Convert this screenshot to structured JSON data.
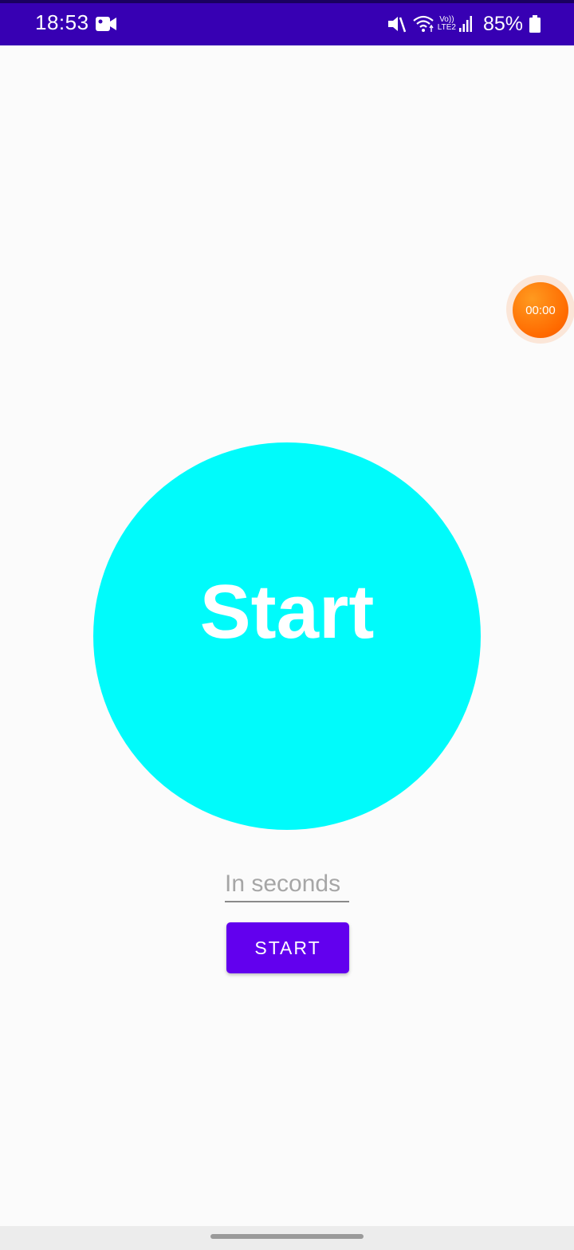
{
  "status_bar": {
    "time": "18:53",
    "volte_line1": "Vo))",
    "volte_line2": "LTE2",
    "battery": "85%"
  },
  "floating_timer": {
    "time": "00:00"
  },
  "circle": {
    "label": "Start",
    "color": "#00fbfb"
  },
  "seconds_input": {
    "placeholder": "In seconds",
    "value": ""
  },
  "start_button": {
    "label": "START",
    "color": "#6200ee"
  },
  "colors": {
    "status_bar": "#3700b3",
    "bubble": "#ff6a00",
    "background": "#fbfbfb"
  },
  "icons": [
    "video-camera-icon",
    "mute-icon",
    "wifi-icon",
    "signal-icon",
    "battery-icon"
  ]
}
